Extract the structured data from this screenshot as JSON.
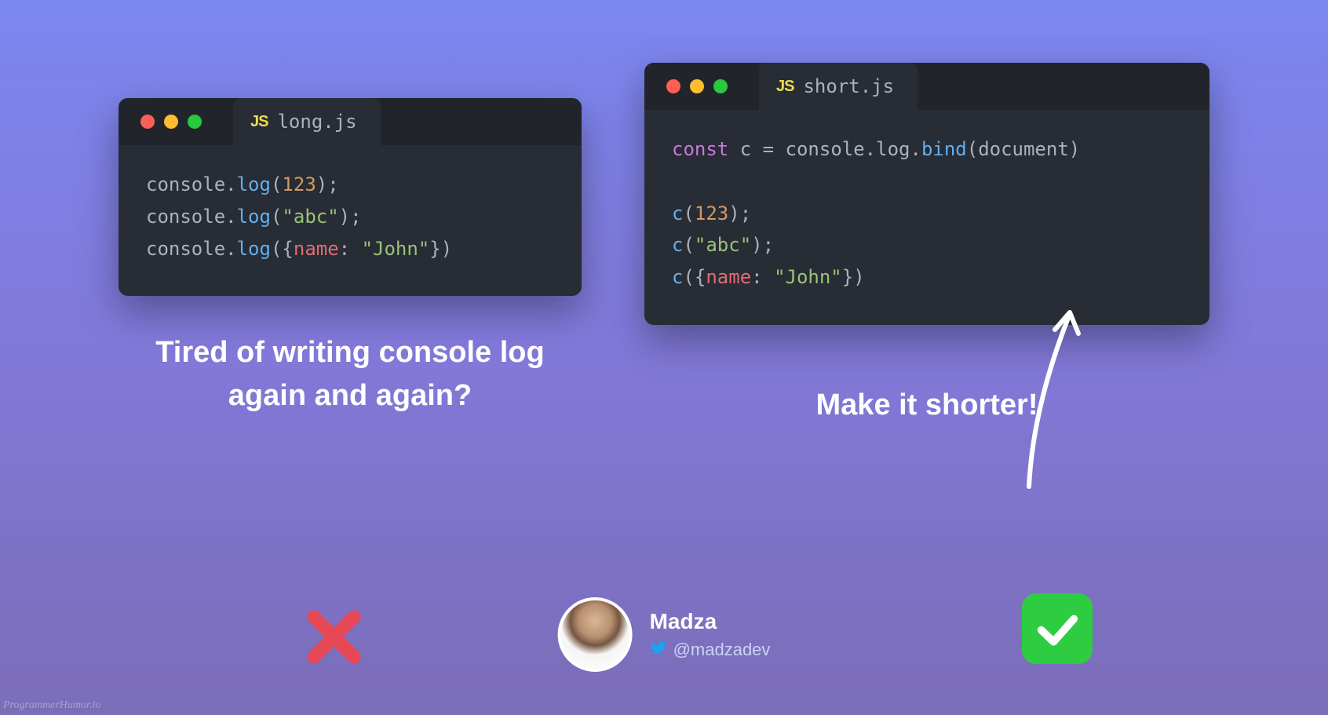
{
  "left": {
    "filename": "long.js",
    "caption": "Tired of writing console log\nagain and again?",
    "code": {
      "l1": {
        "obj": "console",
        "dot": ".",
        "method": "log",
        "open": "(",
        "arg": "123",
        "close": ");"
      },
      "l2": {
        "obj": "console",
        "dot": ".",
        "method": "log",
        "open": "(",
        "arg": "\"abc\"",
        "close": ");"
      },
      "l3": {
        "obj": "console",
        "dot": ".",
        "method": "log",
        "open": "({",
        "prop": "name",
        "colon": ": ",
        "val": "\"John\"",
        "close": "})"
      }
    }
  },
  "right": {
    "filename": "short.js",
    "caption": "Make it shorter!",
    "code": {
      "l1": {
        "kw": "const",
        "sp1": " ",
        "var": "c",
        "eq": " = ",
        "obj": "console",
        "d1": ".",
        "m1": "log",
        "d2": ".",
        "m2": "bind",
        "open": "(",
        "arg": "document",
        "close": ")"
      },
      "l2": {
        "fn": "c",
        "open": "(",
        "arg": "123",
        "close": ");"
      },
      "l3": {
        "fn": "c",
        "open": "(",
        "arg": "\"abc\"",
        "close": ");"
      },
      "l4": {
        "fn": "c",
        "open": "({",
        "prop": "name",
        "colon": ": ",
        "val": "\"John\"",
        "close": "})"
      }
    }
  },
  "author": {
    "name": "Madza",
    "handle": "@madzadev"
  },
  "js_badge": "JS",
  "watermark": "ProgrammerHumor.io"
}
